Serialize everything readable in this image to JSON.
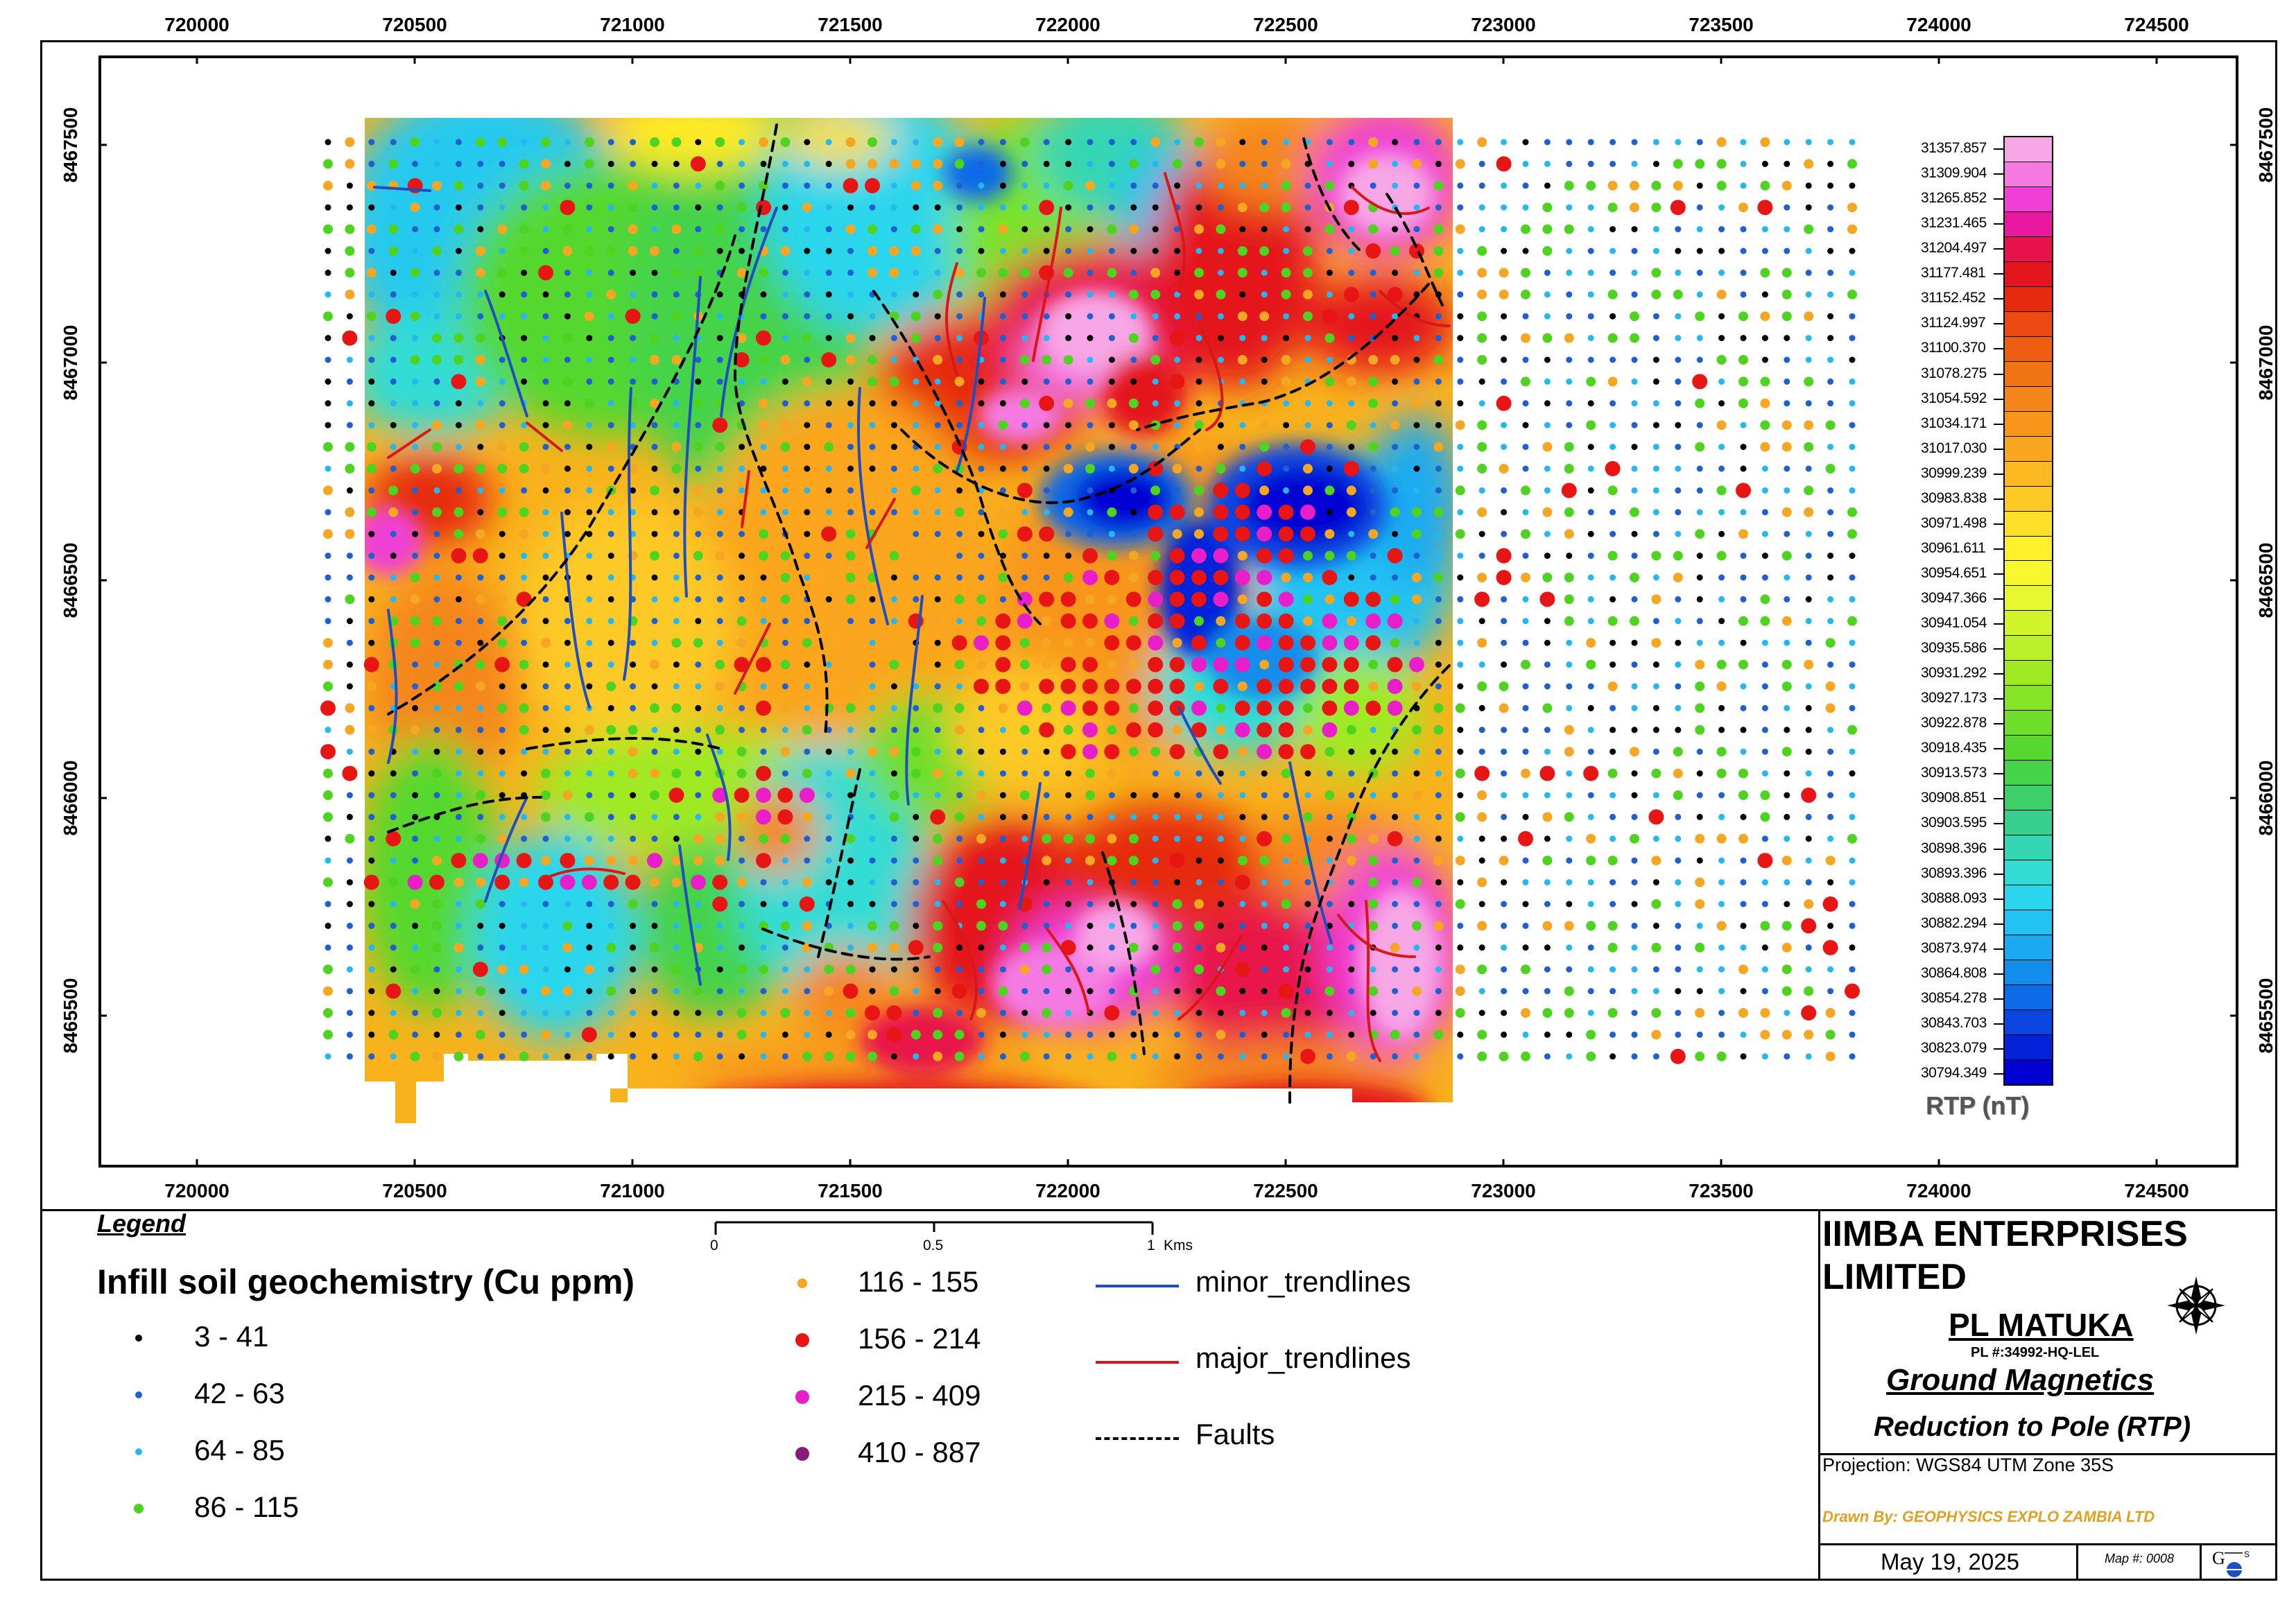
{
  "map": {
    "x_ticks": [
      "720000",
      "720500",
      "721000",
      "721500",
      "722000",
      "722500",
      "723000",
      "723500",
      "724000",
      "724500"
    ],
    "y_ticks": [
      "8467500",
      "8467000",
      "8466500",
      "8466000",
      "8465500"
    ],
    "colorbar": {
      "title": "RTP (nT)",
      "labels": [
        "31357.857",
        "31309.904",
        "31265.852",
        "31231.465",
        "31204.497",
        "31177.481",
        "31152.452",
        "31124.997",
        "31100.370",
        "31078.275",
        "31054.592",
        "31034.171",
        "31017.030",
        "30999.239",
        "30983.838",
        "30971.498",
        "30961.611",
        "30954.651",
        "30947.366",
        "30941.054",
        "30935.586",
        "30931.292",
        "30927.173",
        "30922.878",
        "30918.435",
        "30913.573",
        "30908.851",
        "30903.595",
        "30898.396",
        "30893.396",
        "30888.093",
        "30882.294",
        "30873.974",
        "30864.808",
        "30854.278",
        "30843.703",
        "30823.079",
        "30794.349"
      ],
      "colors": [
        "#f7a6e6",
        "#f47ae2",
        "#ef3fd6",
        "#e8189f",
        "#e8124a",
        "#e4151c",
        "#e62a10",
        "#ec4a12",
        "#ee5e12",
        "#f07412",
        "#f5861a",
        "#f8961c",
        "#fba61f",
        "#fcb820",
        "#fdc925",
        "#fde027",
        "#fef02a",
        "#f7f830",
        "#e6f82e",
        "#d1f52a",
        "#b9f028",
        "#9fea24",
        "#86e426",
        "#6fde2a",
        "#57d82e",
        "#45d34a",
        "#3ccf6a",
        "#38d08e",
        "#35d6b3",
        "#30dcd4",
        "#2ad6ec",
        "#22c3f2",
        "#1aaaf0",
        "#128ceb",
        "#0c6be6",
        "#0846df",
        "#0422d8",
        "#0000d2"
      ]
    },
    "scale_bar": {
      "labels": [
        "0",
        "0.5",
        "1"
      ],
      "unit": "Kms"
    }
  },
  "legend": {
    "title": "Legend",
    "subtitle": "Infill soil geochemistry (Cu ppm)",
    "classes": [
      {
        "label": "3 - 41",
        "color": "#000000",
        "size": "small"
      },
      {
        "label": "42 - 63",
        "color": "#1f5fd0",
        "size": "small"
      },
      {
        "label": "64 - 85",
        "color": "#27b7f0",
        "size": "small"
      },
      {
        "label": "86 - 115",
        "color": "#4ed420",
        "size": "medium"
      },
      {
        "label": "116 - 155",
        "color": "#f5a623",
        "size": "medium"
      },
      {
        "label": "156 - 214",
        "color": "#e81515",
        "size": "large"
      },
      {
        "label": "215 - 409",
        "color": "#e81ec8",
        "size": "large"
      },
      {
        "label": "410 - 887",
        "color": "#8a1a7a",
        "size": "large"
      }
    ],
    "lines": [
      {
        "label": "minor_trendlines",
        "color": "#1f4fbf",
        "style": "solid"
      },
      {
        "label": "major_trendlines",
        "color": "#d81818",
        "style": "solid"
      },
      {
        "label": "Faults",
        "color": "#000000",
        "style": "dashed"
      }
    ]
  },
  "title_block": {
    "company": [
      "IIMBA ENTERPRISES",
      "LIMITED"
    ],
    "licence": "PL MATUKA",
    "licence_no": "PL #:34992-HQ-LEL",
    "survey": "Ground Magnetics",
    "product": "Reduction to Pole (RTP)",
    "projection": "Projection: WGS84 UTM Zone 35S",
    "drawn_by": "Drawn By: GEOPHYSICS EXPLO ZAMBIA LTD",
    "date": "May 19, 2025",
    "map_no": "Map #: 0008",
    "accent_color": "#e0a020"
  },
  "icons": {
    "north_arrow": "compass-rose-icon",
    "logo": "gs-logo-icon"
  }
}
